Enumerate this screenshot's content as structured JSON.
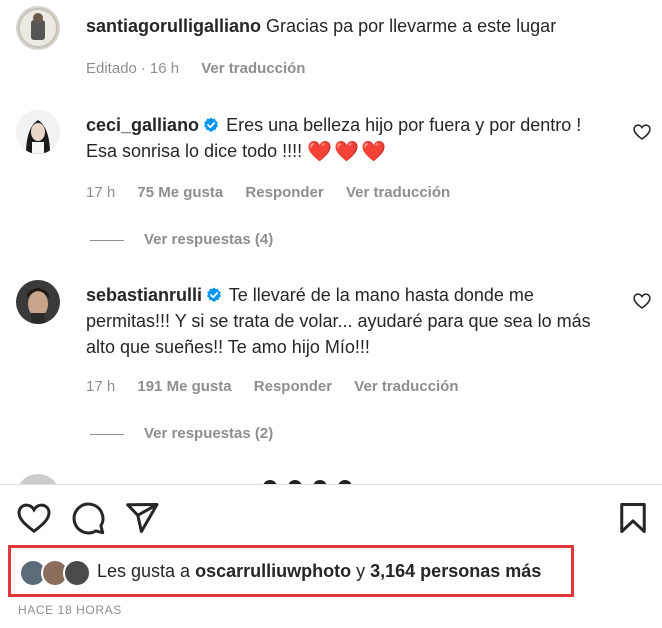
{
  "comments": [
    {
      "user": "santiagorulligalliano",
      "text": "Gracias pa por llevarme a este lugar",
      "edited": "Editado",
      "time": "16 h",
      "translate": "Ver traducción"
    },
    {
      "user": "ceci_galliano",
      "verified": true,
      "text_line1": "Eres una belleza hijo por fuera y por dentro !",
      "text_line2": "Esa sonrisa lo dice todo !!!!",
      "hearts": "❤️❤️❤️",
      "time": "17 h",
      "likes": "75 Me gusta",
      "reply": "Responder",
      "translate": "Ver traducción",
      "view_replies": "Ver respuestas (4)"
    },
    {
      "user": "sebastianrulli",
      "verified": true,
      "text_line1": "Te llevaré de la mano hasta donde me",
      "text_line2": "permitas!!! Y si se trata de volar... ayudaré para que sea lo más",
      "text_line3": "alto que sueñes!! Te amo hijo Mío!!!",
      "time": "17 h",
      "likes": "191 Me gusta",
      "reply": "Responder",
      "translate": "Ver traducción",
      "view_replies": "Ver respuestas (2)"
    }
  ],
  "likes": {
    "prefix": "Les gusta a",
    "user": "oscarrulliuwphoto",
    "joiner": "y",
    "others": "3,164 personas más"
  },
  "timestamp": "HACE 18 HORAS",
  "colors": {
    "highlight_border": "#e0383a",
    "verified_blue": "#0095f6",
    "muted_text": "#8e8e8e"
  },
  "icons": [
    "heart-icon",
    "comment-icon",
    "share-icon",
    "bookmark-icon",
    "verified-icon"
  ]
}
